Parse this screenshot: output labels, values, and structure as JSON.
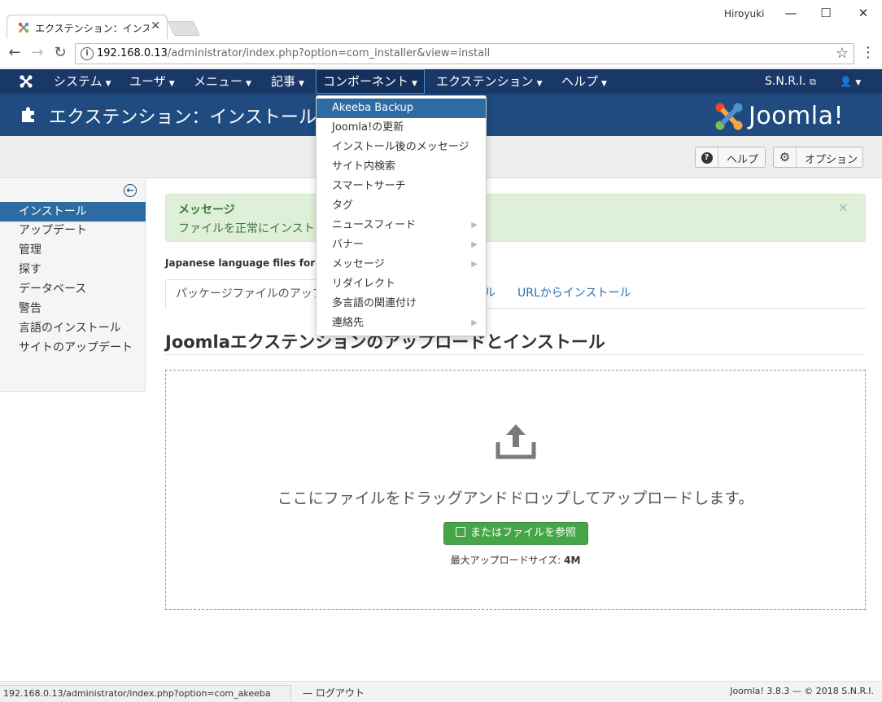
{
  "browser": {
    "tab_title": "エクステンション：インストール",
    "close_glyph": "✕",
    "user": "Hiroyuki",
    "min_glyph": "—",
    "max_glyph": "☐",
    "win_close_glyph": "✕",
    "back_glyph": "←",
    "forward_glyph": "→",
    "reload_glyph": "↻",
    "url_host": "192.168.0.13",
    "url_path": "/administrator/index.php?option=com_installer&view=install",
    "star_glyph": "☆",
    "menu_glyph": "⋮"
  },
  "nav": {
    "items": [
      {
        "label": "システム"
      },
      {
        "label": "ユーザ"
      },
      {
        "label": "メニュー"
      },
      {
        "label": "記事"
      },
      {
        "label": "コンポーネント"
      },
      {
        "label": "エクステンション"
      },
      {
        "label": "ヘルプ"
      }
    ],
    "caret": "▼",
    "site_name": "S.N.R.I.",
    "external_glyph": "⧉",
    "user_glyph": "👤"
  },
  "header": {
    "title": "エクステンション：インストール",
    "brand": "Joomla!"
  },
  "toolbar": {
    "help_icon": "?",
    "help_label": "ヘルプ",
    "options_icon": "⚙",
    "options_label": "オプション"
  },
  "sidebar": {
    "toggle_glyph": "←",
    "items": [
      {
        "label": "インストール"
      },
      {
        "label": "アップデート"
      },
      {
        "label": "管理"
      },
      {
        "label": "探す"
      },
      {
        "label": "データベース"
      },
      {
        "label": "警告"
      },
      {
        "label": "言語のインストール"
      },
      {
        "label": "サイトのアップデート"
      }
    ]
  },
  "message": {
    "heading": "メッセージ",
    "text": "ファイルを正常にインストー",
    "close_glyph": "×"
  },
  "language_text": "Japanese language files for Al",
  "tabs": [
    {
      "label": "パッケージファイルのアップロ"
    },
    {
      "label": "ル"
    },
    {
      "label": "URLからインストール"
    }
  ],
  "section_title": "Joomlaエクステンションのアップロードとインストール",
  "dropzone": {
    "text": "ここにファイルをドラッグアンドドロップしてアップロードします。",
    "button_label": "またはファイルを参照",
    "max_label": "最大アップロードサイズ:",
    "max_value": "4M"
  },
  "dropdown": {
    "items": [
      {
        "label": "Akeeba Backup"
      },
      {
        "label": "Joomla!の更新"
      },
      {
        "label": "インストール後のメッセージ"
      },
      {
        "label": "サイト内検索"
      },
      {
        "label": "スマートサーチ"
      },
      {
        "label": "タグ"
      },
      {
        "label": "ニュースフィード"
      },
      {
        "label": "バナー"
      },
      {
        "label": "メッセージ"
      },
      {
        "label": "リダイレクト"
      },
      {
        "label": "多言語の関連付け"
      },
      {
        "label": "連絡先"
      }
    ],
    "submenu_glyph": "▶"
  },
  "status": {
    "url": "192.168.0.13/administrator/index.php?option=com_akeeba",
    "logout_label": "ログアウト",
    "logout_glyph": "—",
    "copyright": "Joomla! 3.8.3 — © 2018 S.N.R.I."
  },
  "colors": {
    "nav_bg": "#1a3867",
    "header_bg": "#1f4b80",
    "active_blue": "#2d6ca2",
    "success_green": "#46a546"
  }
}
